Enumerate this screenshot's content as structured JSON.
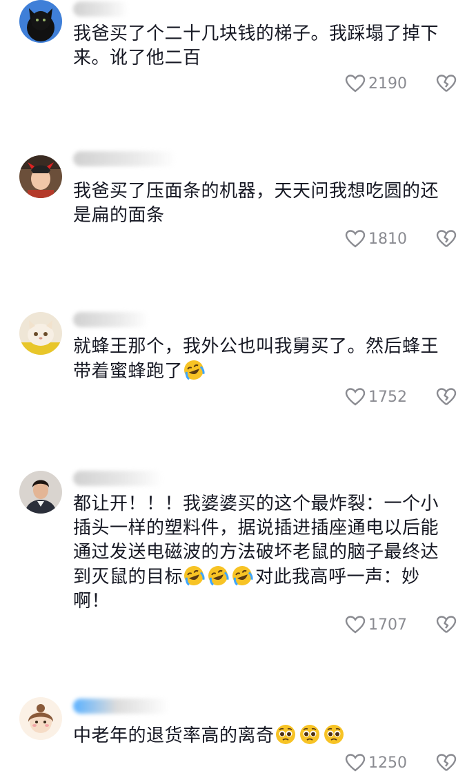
{
  "comments": [
    {
      "avatar": "black-cat-avatar",
      "text": "我爸买了个二十几块钱的梯子。我踩塌了掉下来。讹了他二百",
      "likes": "2190"
    },
    {
      "avatar": "child-photo-avatar",
      "text": "我爸买了压面条的机器，天天问我想吃圆的还是扁的面条",
      "likes": "1810"
    },
    {
      "avatar": "white-cat-avatar",
      "text": "就蜂王那个，我外公也叫我舅买了。然后蜂王带着蜜蜂跑了",
      "emojis": [
        "rofl-emoji"
      ],
      "likes": "1752"
    },
    {
      "avatar": "man-portrait-avatar",
      "text_before": "都让开！！！我婆婆买的这个最炸裂：一个小插头一样的塑料件，据说插进插座通电以后能通过发送电磁波的方法破坏老鼠的脑子最终达到灭鼠的目标",
      "emojis": [
        "rofl-emoji",
        "rofl-emoji",
        "rofl-emoji"
      ],
      "text_after": "对此我高呼一声：妙啊！",
      "likes": "1707"
    },
    {
      "avatar": "cartoon-girl-avatar",
      "text": "中老年的退货率高的离奇",
      "emojis": [
        "pleading-emoji",
        "pleading-emoji",
        "pleading-emoji"
      ],
      "likes": "1250"
    }
  ],
  "icons": {
    "like": "heart-outline-icon",
    "dislike": "broken-heart-icon"
  },
  "colors": {
    "text": "#161823",
    "count": "#8a8b91",
    "icon": "#8a8b91"
  }
}
